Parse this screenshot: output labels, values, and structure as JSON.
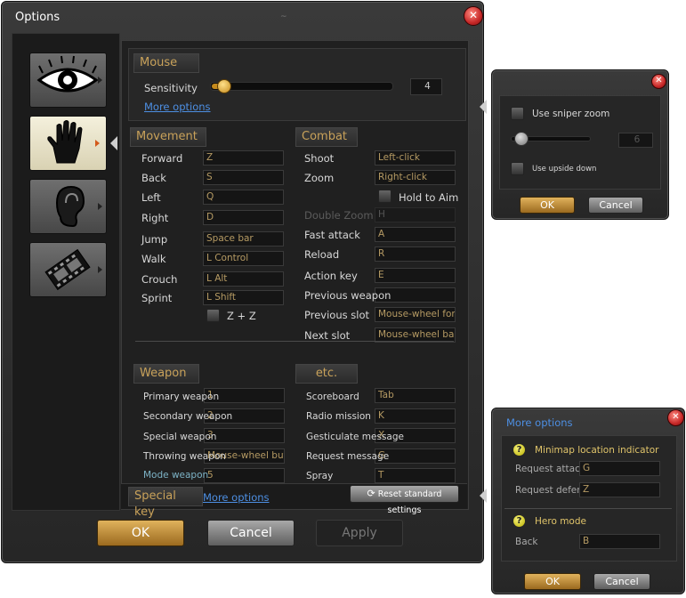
{
  "window": {
    "title": "Options",
    "close_glyph": "✕"
  },
  "tabs": [
    {
      "icon": "eye-icon"
    },
    {
      "icon": "hand-icon"
    },
    {
      "icon": "ear-icon"
    },
    {
      "icon": "film-icon"
    }
  ],
  "mouse": {
    "title": "Mouse",
    "sensitivity_label": "Sensitivity",
    "sensitivity_value": "4",
    "sensitivity_level": 0.06,
    "more_options": "More options"
  },
  "movement": {
    "title": "Movement",
    "rows": [
      {
        "label": "Forward",
        "value": "Z"
      },
      {
        "label": "Back",
        "value": "S"
      },
      {
        "label": "Left",
        "value": "Q"
      },
      {
        "label": "Right",
        "value": "D"
      },
      {
        "label": "Jump",
        "value": "Space bar"
      },
      {
        "label": "Walk",
        "value": "L Control"
      },
      {
        "label": "Crouch",
        "value": "L Alt"
      },
      {
        "label": "Sprint",
        "value": "L Shift"
      }
    ],
    "zz_label": "Z + Z"
  },
  "combat": {
    "title": "Combat",
    "shoot_label": "Shoot",
    "shoot_value": "Left-click",
    "zoom_label": "Zoom",
    "zoom_value": "Right-click",
    "hold_to_aim": "Hold to Aim",
    "double_zoom_label": "Double Zoom",
    "double_zoom_value": "H",
    "fast_attack_label": "Fast attack",
    "fast_attack_value": "A",
    "reload_label": "Reload",
    "reload_value": "R",
    "action_label": "Action key",
    "action_value": "E",
    "prev_weapon_label": "Previous weapon",
    "prev_weapon_value": "",
    "prev_slot_label": "Previous slot",
    "prev_slot_value": "Mouse-wheel forw",
    "next_slot_label": "Next slot",
    "next_slot_value": "Mouse-wheel back"
  },
  "weapon": {
    "title": "Weapon",
    "primary_label": "Primary weapon",
    "primary_value": "1",
    "secondary_label": "Secondary weapon",
    "secondary_value": "2",
    "special_label": "Special weapon",
    "special_value": "3",
    "throwing_label": "Throwing weapon",
    "throwing_value": "Mouse-wheel butt",
    "mode_label": "Mode weapon",
    "mode_value": "5"
  },
  "etc": {
    "title": "etc.",
    "scoreboard_label": "Scoreboard",
    "scoreboard_value": "Tab",
    "radio_label": "Radio mission",
    "radio_value": "K",
    "gesticulate_label": "Gesticulate message",
    "gesticulate_value": "X",
    "request_label": "Request message",
    "request_value": "G",
    "spray_label": "Spray",
    "spray_value": "T"
  },
  "special_key": {
    "title": "Special key",
    "more_options": "More options"
  },
  "reset_button": "Reset standard settings",
  "footer": {
    "ok": "OK",
    "cancel": "Cancel",
    "apply": "Apply"
  },
  "sniper_popup": {
    "use_sniper_zoom": "Use sniper zoom",
    "slider_value": "6",
    "slider_level": 0.05,
    "use_upside_down": "Use upside down",
    "ok": "OK",
    "cancel": "Cancel"
  },
  "more_popup": {
    "title": "More options",
    "minimap_heading": "Minimap location indicator",
    "request_attack_label": "Request attack",
    "request_attack_value": "G",
    "request_defence_label": "Request defence",
    "request_defence_value": "Z",
    "hero_heading": "Hero mode",
    "back_label": "Back",
    "back_value": "B",
    "ok": "OK",
    "cancel": "Cancel"
  },
  "colors": {
    "accent_gold": "#c9a25a",
    "link_blue": "#4d8fe3",
    "close_red": "#c62828"
  }
}
